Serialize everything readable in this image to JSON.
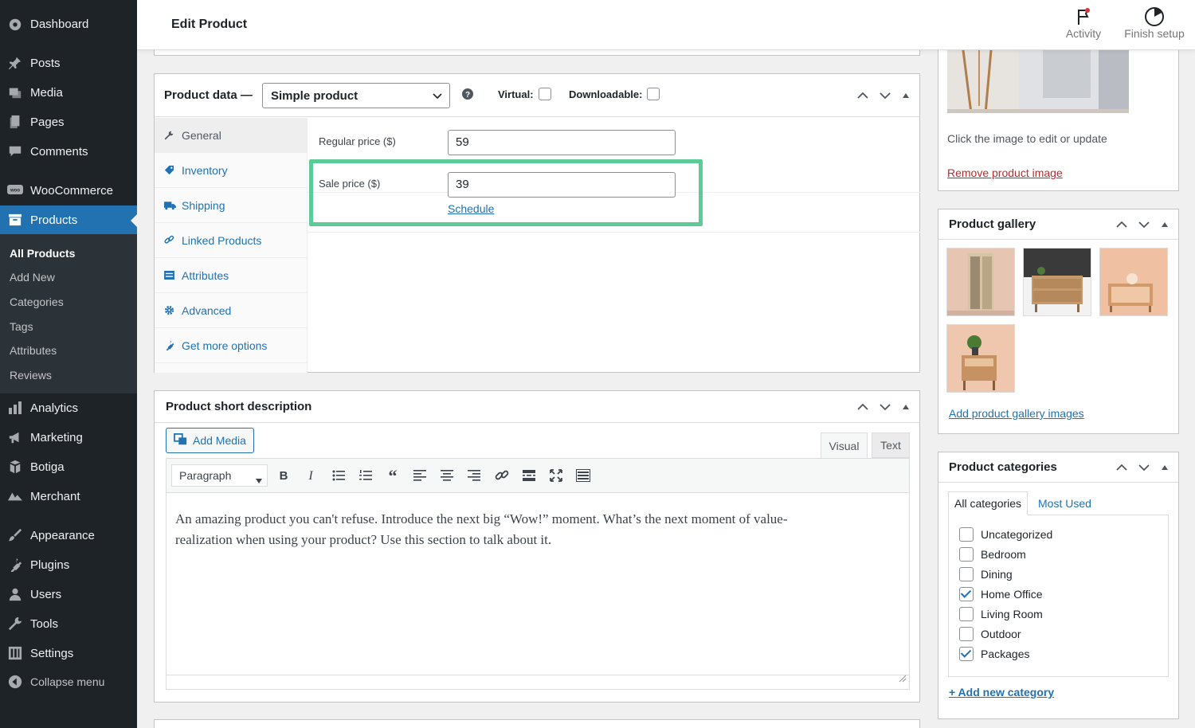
{
  "sidebar": {
    "items": [
      {
        "label": "Dashboard",
        "icon": "dashboard-icon"
      },
      {
        "label": "Posts",
        "icon": "pin-icon"
      },
      {
        "label": "Media",
        "icon": "media-icon"
      },
      {
        "label": "Pages",
        "icon": "page-icon"
      },
      {
        "label": "Comments",
        "icon": "comment-icon"
      },
      {
        "label": "WooCommerce",
        "icon": "woo-icon"
      },
      {
        "label": "Products",
        "icon": "archive-icon"
      },
      {
        "label": "Analytics",
        "icon": "bar-chart-icon"
      },
      {
        "label": "Marketing",
        "icon": "megaphone-icon"
      },
      {
        "label": "Botiga",
        "icon": "store-icon"
      },
      {
        "label": "Merchant",
        "icon": "merchant-icon"
      },
      {
        "label": "Appearance",
        "icon": "brush-icon"
      },
      {
        "label": "Plugins",
        "icon": "plug-icon"
      },
      {
        "label": "Users",
        "icon": "user-icon"
      },
      {
        "label": "Tools",
        "icon": "wrench-icon"
      },
      {
        "label": "Settings",
        "icon": "settings-icon"
      }
    ],
    "submenu": [
      "All Products",
      "Add New",
      "Categories",
      "Tags",
      "Attributes",
      "Reviews"
    ],
    "collapse_label": "Collapse menu"
  },
  "header": {
    "title": "Edit Product",
    "activity_label": "Activity",
    "finish_label": "Finish setup"
  },
  "product_data": {
    "title": "Product data —",
    "type_value": "Simple product",
    "virtual_label": "Virtual:",
    "downloadable_label": "Downloadable:",
    "tabs": [
      "General",
      "Inventory",
      "Shipping",
      "Linked Products",
      "Attributes",
      "Advanced",
      "Get more options"
    ],
    "regular_price_label": "Regular price ($)",
    "regular_price_value": "59",
    "sale_price_label": "Sale price ($)",
    "sale_price_value": "39",
    "schedule_label": "Schedule",
    "highlight_color": "#5ccb97"
  },
  "short_description": {
    "title": "Product short description",
    "add_media_label": "Add Media",
    "visual_tab": "Visual",
    "text_tab": "Text",
    "format_value": "Paragraph",
    "content_line1": "An amazing product you can't refuse. Introduce the next big “Wow!” moment. What’s the next moment of value-",
    "content_line2": "realization when using your product? Use this section to talk about it."
  },
  "product_image": {
    "hint": "Click the image to edit or update",
    "remove_label": "Remove product image"
  },
  "gallery": {
    "title": "Product gallery",
    "add_label": "Add product gallery images"
  },
  "categories": {
    "title": "Product categories",
    "tab_all": "All categories",
    "tab_used": "Most Used",
    "items": [
      {
        "label": "Uncategorized",
        "checked": false
      },
      {
        "label": "Bedroom",
        "checked": false
      },
      {
        "label": "Dining",
        "checked": false
      },
      {
        "label": "Home Office",
        "checked": true
      },
      {
        "label": "Living Room",
        "checked": false
      },
      {
        "label": "Outdoor",
        "checked": false
      },
      {
        "label": "Packages",
        "checked": true
      }
    ],
    "add_label": "+ Add new category"
  },
  "colors": {
    "accent": "#2271b1",
    "sidebar_bg": "#1d2327",
    "highlight": "#5ccb97"
  }
}
